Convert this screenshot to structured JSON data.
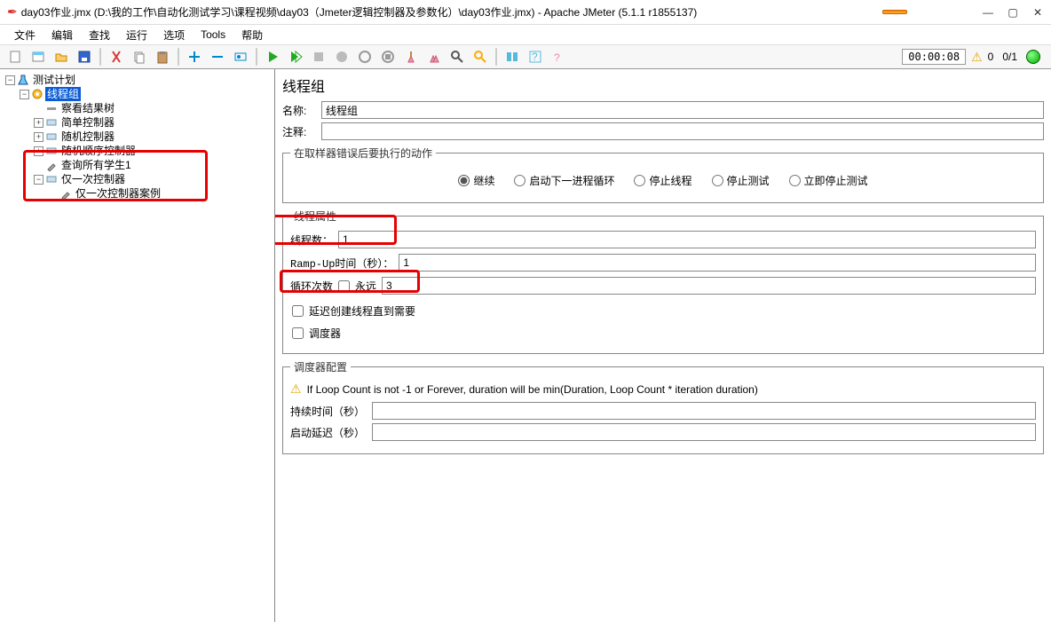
{
  "window": {
    "title": "day03作业.jmx (D:\\我的工作\\自动化测试学习\\课程视频\\day03（Jmeter逻辑控制器及参数化）\\day03作业.jmx) - Apache JMeter (5.1.1 r1855137)"
  },
  "menu": {
    "file": "文件",
    "edit": "编辑",
    "find": "查找",
    "run": "运行",
    "options": "选项",
    "tools": "Tools",
    "help": "帮助"
  },
  "status": {
    "time": "00:00:08",
    "threads": "0/1",
    "warn_count": "0"
  },
  "tree": {
    "root": "测试计划",
    "thread_group": "线程组",
    "view_results": "察看结果树",
    "simple_ctrl": "简单控制器",
    "random_ctrl": "随机控制器",
    "random_order_ctrl": "随机顺序控制器",
    "sampler_query": "查询所有学生1",
    "once_only_ctrl": "仅一次控制器",
    "once_only_case": "仅一次控制器案例"
  },
  "panel": {
    "heading": "线程组",
    "name_label": "名称:",
    "name_value": "线程组",
    "comment_label": "注释:",
    "comment_value": "",
    "on_error_legend": "在取样器错误后要执行的动作",
    "radios": {
      "continue": "继续",
      "start_next": "启动下一进程循环",
      "stop_thread": "停止线程",
      "stop_test": "停止测试",
      "stop_now": "立即停止测试"
    },
    "thread_props_legend": "线程属性",
    "threads_label": "线程数：",
    "threads_value": "1",
    "rampup_label": "Ramp-Up时间（秒）：",
    "rampup_value": "1",
    "loops_label": "循环次数",
    "forever_label": "永远",
    "loops_value": "3",
    "delay_create_label": "延迟创建线程直到需要",
    "scheduler_label": "调度器",
    "scheduler_legend": "调度器配置",
    "scheduler_warn": "If Loop Count is not -1 or Forever, duration will be min(Duration, Loop Count * iteration duration)",
    "duration_label": "持续时间（秒）",
    "startup_delay_label": "启动延迟（秒）"
  }
}
